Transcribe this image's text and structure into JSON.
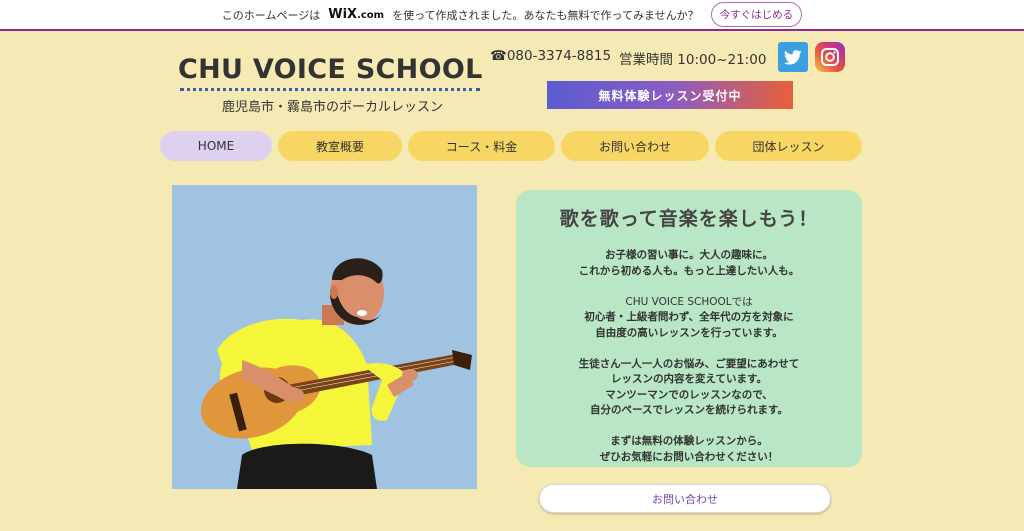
{
  "wix_banner": {
    "text_before": "このホームページは",
    "logo": "WiX",
    "logo_suffix": ".com",
    "text_after": "を使って作成されました。あなたも無料で作ってみませんか？",
    "button_label": "今すぐはじめる"
  },
  "header": {
    "logo": "CHU VOICE SCHOOL",
    "subtitle": "鹿児島市・霧島市のボーカルレッスン",
    "phone": "☎080-3374-8815",
    "hours": "営業時間 10:00~21:00",
    "trial_banner": "無料体験レッスン受付中"
  },
  "nav": {
    "items": [
      {
        "label": "HOME"
      },
      {
        "label": "教室概要"
      },
      {
        "label": "コース・料金"
      },
      {
        "label": "お問い合わせ"
      },
      {
        "label": "団体レッスン"
      }
    ]
  },
  "card": {
    "title": "歌を歌って音楽を楽しもう！",
    "lines": [
      "お子様の習い事に。大人の趣味に。",
      "これから初める人も。もっと上達したい人も。",
      "CHU VOICE SCHOOLでは",
      "初心者・上級者問わず、全年代の方を対象に",
      "自由度の高いレッスンを行っています。",
      "生徒さん一人一人のお悩み、ご要望にあわせて",
      "レッスンの内容を変えています。",
      "マンツーマンでのレッスンなので、",
      "自分のペースでレッスンを続けられます。",
      "まずは無料の体験レッスンから。",
      "ぜひお気軽にお問い合わせください！"
    ]
  },
  "contact_button": "お問い合わせ",
  "colors": {
    "page_bg": "#f5e9b4",
    "nav_bg": "#f8d664",
    "nav_active": "#ddd1ef",
    "card_bg": "#b9e6c4",
    "image_bg": "#9fc3e0"
  },
  "icons": [
    "twitter-icon",
    "instagram-icon"
  ]
}
